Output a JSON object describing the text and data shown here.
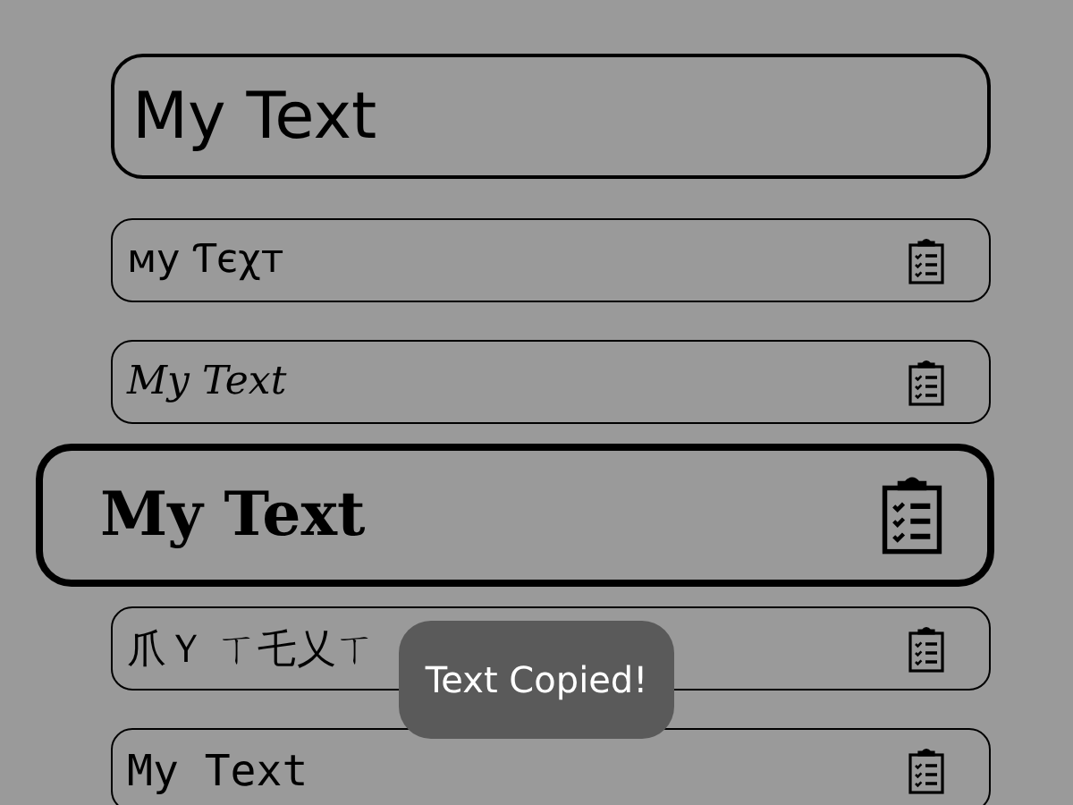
{
  "input": {
    "value": "My Text"
  },
  "results": [
    {
      "text": "мy Ƭєχт",
      "kind": "plain",
      "selected": false
    },
    {
      "text": "My Text",
      "kind": "script",
      "selected": false
    },
    {
      "text": "My Text",
      "kind": "blackletter",
      "selected": true
    },
    {
      "text": "爪Ｙ ㄒ乇乂ㄒ",
      "kind": "plain",
      "selected": false
    },
    {
      "text": "My Text",
      "kind": "mono",
      "selected": false
    }
  ],
  "toast": {
    "text": "Text Copied!"
  }
}
